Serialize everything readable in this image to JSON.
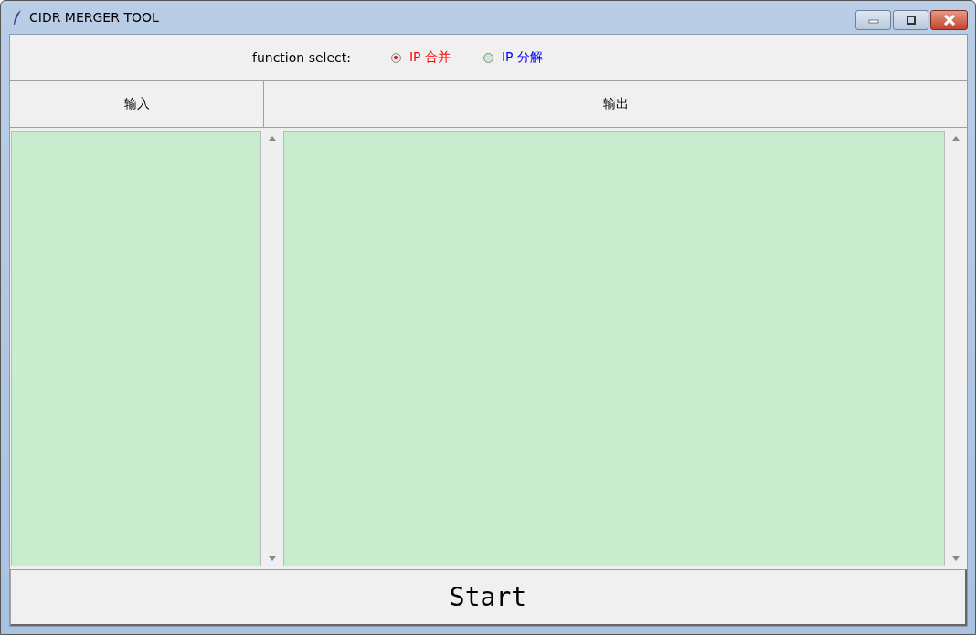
{
  "window": {
    "title": "CIDR MERGER TOOL"
  },
  "function_select": {
    "label": "function select:",
    "options": [
      {
        "label": "IP 合并",
        "selected": true,
        "color": "#ff0000"
      },
      {
        "label": "IP 分解",
        "selected": false,
        "color": "#0000ff"
      }
    ]
  },
  "panes": [
    {
      "heading": "输入"
    },
    {
      "heading": "输出"
    }
  ],
  "start_button": {
    "label": "Start"
  }
}
